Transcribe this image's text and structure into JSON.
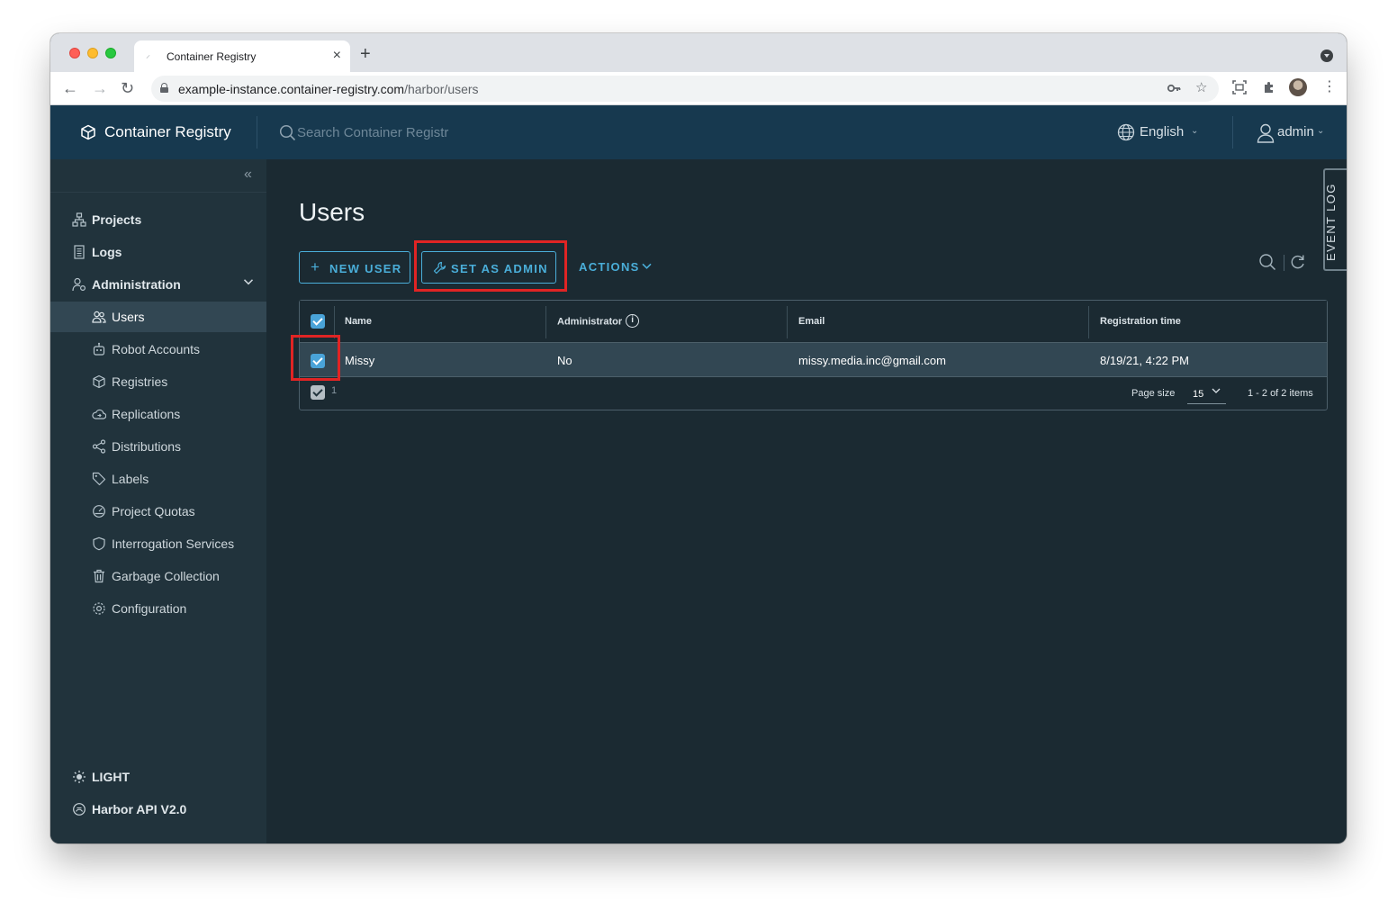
{
  "browser": {
    "tab_title": "Container Registry",
    "url_host": "example-instance.container-registry.com",
    "url_path": "/harbor/users"
  },
  "header": {
    "brand": "Container Registry",
    "search_placeholder": "Search Container Registr",
    "language": "English",
    "user": "admin"
  },
  "sidebar": {
    "items": [
      {
        "label": "Projects",
        "icon": "projects-icon"
      },
      {
        "label": "Logs",
        "icon": "logs-icon"
      },
      {
        "label": "Administration",
        "icon": "administration-icon"
      }
    ],
    "admin_items": [
      {
        "label": "Users",
        "icon": "users-icon",
        "active": true
      },
      {
        "label": "Robot Accounts",
        "icon": "robot-icon"
      },
      {
        "label": "Registries",
        "icon": "registries-icon"
      },
      {
        "label": "Replications",
        "icon": "replications-icon"
      },
      {
        "label": "Distributions",
        "icon": "distributions-icon"
      },
      {
        "label": "Labels",
        "icon": "labels-icon"
      },
      {
        "label": "Project Quotas",
        "icon": "quotas-icon"
      },
      {
        "label": "Interrogation Services",
        "icon": "interrogation-icon"
      },
      {
        "label": "Garbage Collection",
        "icon": "trash-icon"
      },
      {
        "label": "Configuration",
        "icon": "gear-icon"
      }
    ],
    "theme_label": "LIGHT",
    "api_label": "Harbor API V2.0"
  },
  "main": {
    "title": "Users",
    "new_user_label": "NEW USER",
    "set_admin_label": "SET AS ADMIN",
    "actions_label": "ACTIONS",
    "event_log_label": "EVENT LOG"
  },
  "table": {
    "columns": [
      "Name",
      "Administrator",
      "Email",
      "Registration time"
    ],
    "rows": [
      {
        "name": "Missy",
        "administrator": "No",
        "email": "missy.media.inc@gmail.com",
        "registration_time": "8/19/21, 4:22 PM",
        "selected": true
      }
    ],
    "selected_count": "1",
    "page_size_label": "Page size",
    "page_size": "15",
    "page_range": "1 - 2 of 2 items"
  },
  "colors": {
    "accent": "#4aaed9",
    "highlight": "#e02424",
    "header_bg": "#17394f",
    "sidebar_bg": "#21333c",
    "main_bg": "#1b2a32"
  }
}
